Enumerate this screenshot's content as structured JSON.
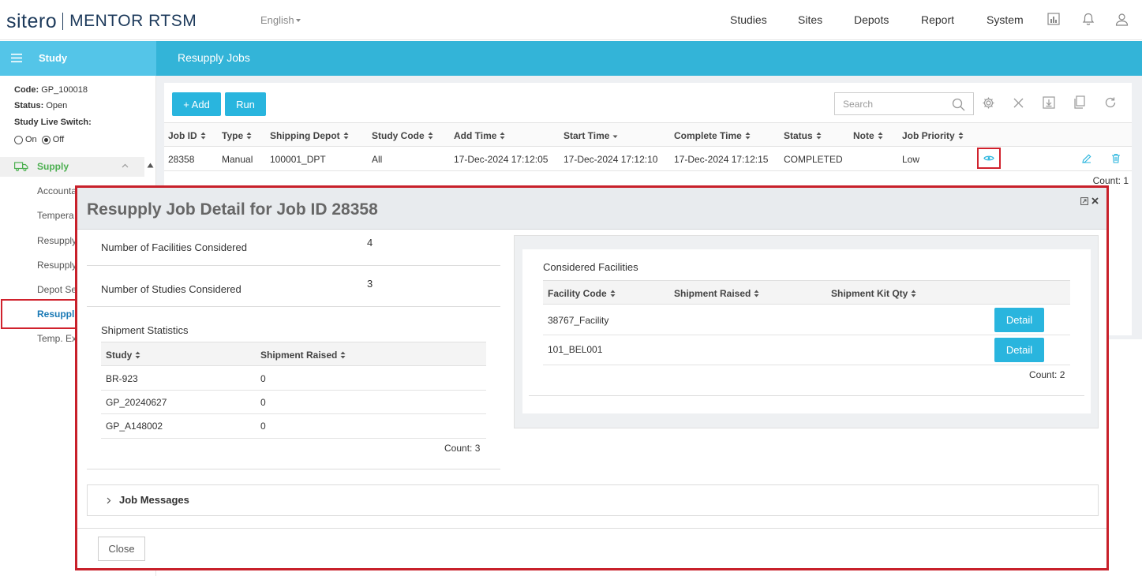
{
  "header": {
    "brand": "sitero",
    "product": "MENTOR RTSM",
    "language": "English",
    "nav": [
      "Studies",
      "Sites",
      "Depots",
      "Report",
      "System"
    ]
  },
  "sidebar": {
    "title": "Study",
    "code_label": "Code:",
    "code_value": "GP_100018",
    "status_label": "Status:",
    "status_value": "Open",
    "live_switch_label": "Study Live Switch:",
    "on_label": "On",
    "off_label": "Off",
    "live_switch_selected": "Off",
    "section": "Supply",
    "items": [
      "Accounta",
      "Tempera",
      "Resupply",
      "Resupply",
      "Depot Se",
      "Resuppli",
      "Temp. Ex"
    ]
  },
  "page": {
    "title": "Resupply Jobs",
    "add_label": "+ Add",
    "run_label": "Run",
    "search_placeholder": "Search",
    "columns": [
      "Job ID",
      "Type",
      "Shipping Depot",
      "Study Code",
      "Add Time",
      "Start Time",
      "Complete Time",
      "Status",
      "Note",
      "Job Priority"
    ],
    "row": {
      "job_id": "28358",
      "type": "Manual",
      "shipping_depot": "100001_DPT",
      "study_code": "All",
      "add_time": "17-Dec-2024 17:12:05",
      "start_time": "17-Dec-2024 17:12:10",
      "complete_time": "17-Dec-2024 17:12:15",
      "status": "COMPLETED",
      "note": "",
      "job_priority": "Low"
    },
    "count": "Count: 1"
  },
  "modal": {
    "title": "Resupply Job Detail for Job ID 28358",
    "facilities_label": "Number of Facilities Considered",
    "facilities_value": "4",
    "studies_label": "Number of Studies Considered",
    "studies_value": "3",
    "shipment_stats_title": "Shipment Statistics",
    "shipment_columns": [
      "Study",
      "Shipment Raised"
    ],
    "shipment_rows": [
      {
        "study": "BR-923",
        "raised": "0"
      },
      {
        "study": "GP_20240627",
        "raised": "0"
      },
      {
        "study": "GP_A148002",
        "raised": "0"
      }
    ],
    "shipment_count": "Count: 3",
    "facilities_title": "Considered Facilities",
    "facility_columns": [
      "Facility Code",
      "Shipment Raised",
      "Shipment Kit Qty"
    ],
    "facility_rows": [
      {
        "code": "38767_Facility",
        "raised": "",
        "kit_qty": "",
        "button": "Detail"
      },
      {
        "code": "101_BEL001",
        "raised": "",
        "kit_qty": "",
        "button": "Detail"
      }
    ],
    "facility_count": "Count: 2",
    "job_messages": "Job Messages",
    "close_label": "Close"
  },
  "colors": {
    "accent": "#29b5de",
    "header_band": "#33b4d8",
    "highlight": "#d0222d",
    "supply_green": "#4caf50"
  }
}
